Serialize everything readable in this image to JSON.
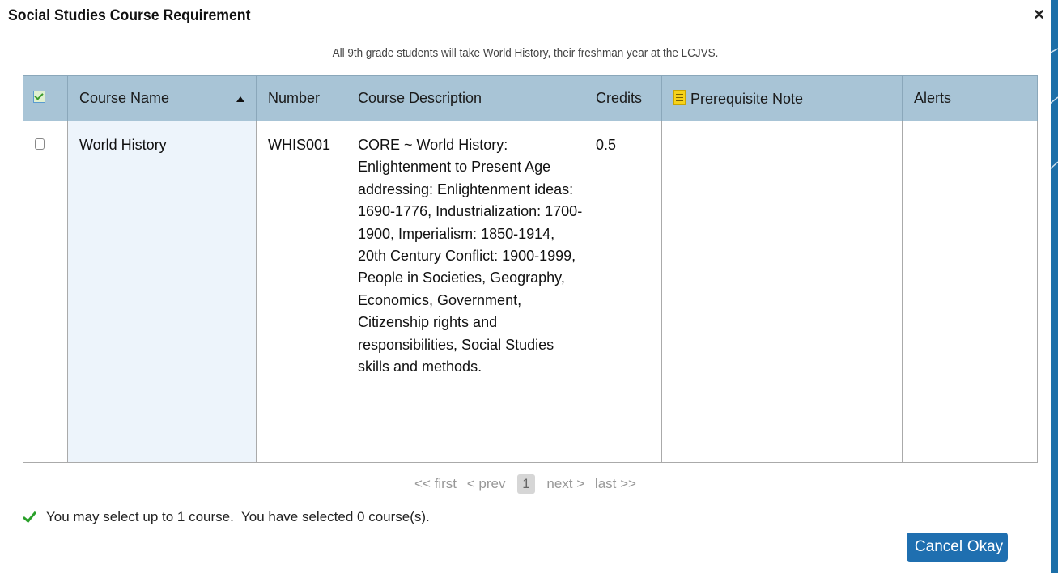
{
  "dialog": {
    "title": "Social Studies Course Requirement",
    "close_symbol": "×",
    "subtitle": "All 9th grade students will take World History, their freshman year at the LCJVS."
  },
  "table": {
    "columns": {
      "course_name": "Course Name",
      "number": "Number",
      "description": "Course Description",
      "credits": "Credits",
      "prerequisite": "Prerequisite Note",
      "alerts": "Alerts"
    },
    "rows": [
      {
        "selected": false,
        "course_name": "World History",
        "number": "WHIS001",
        "description": "CORE ~ World History: Enlightenment to Present Age addressing: Enlightenment ideas: 1690-1776, Industrialization: 1700-1900, Imperialism: 1850-1914, 20th Century Conflict: 1900-1999, People in Societies, Geography, Economics, Government, Citizenship rights and responsibilities, Social Studies skills and methods.",
        "credits": "0.5",
        "prerequisite": "",
        "alerts": ""
      }
    ]
  },
  "pager": {
    "first": "<< first",
    "prev": "< prev",
    "current": "1",
    "next": "next >",
    "last": "last >>"
  },
  "status": {
    "message": "You may select up to 1 course.  You have selected 0 course(s)."
  },
  "buttons": {
    "cancel": "Cancel",
    "okay": "Okay"
  },
  "colors": {
    "header_bg": "#a8c4d6",
    "button_bg": "#1f6fb0",
    "page_bg": "#1d6fa8",
    "success": "#2aa02a"
  },
  "icons": {
    "close": "close-icon",
    "sort": "sort-ascending-icon",
    "note": "note-icon",
    "status": "checkmark-icon"
  }
}
